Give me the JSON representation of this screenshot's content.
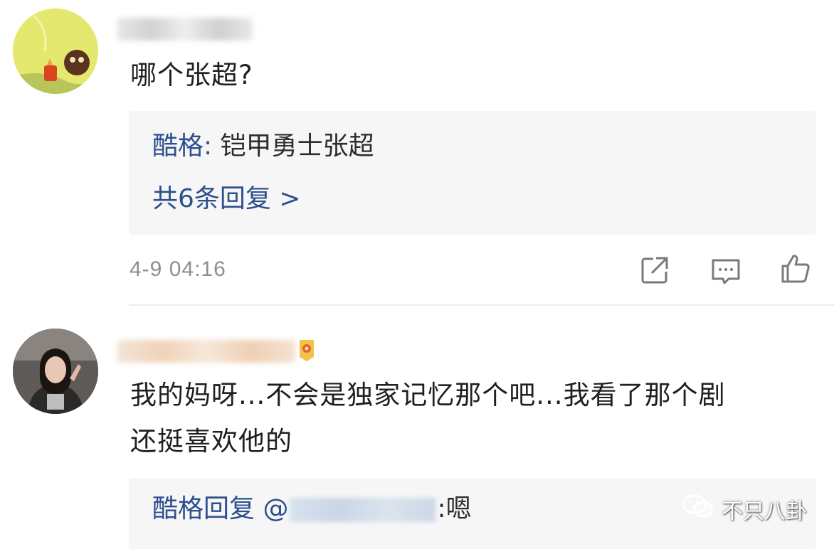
{
  "comments": [
    {
      "text": "哪个张超?",
      "reply_preview": {
        "author": "酷格:",
        "text": " 铠甲勇士张超",
        "more_label": "共6条回复 >"
      },
      "time": "4-9 04:16",
      "actions": [
        "share-icon",
        "comment-icon",
        "like-icon"
      ]
    },
    {
      "text_line1": "我的妈呀...不会是独家记忆那个吧...我看了那个剧",
      "text_line2": "还挺喜欢他的",
      "reply_preview": {
        "author_prefix": "酷格回复 @",
        "suffix": ":嗯"
      }
    }
  ],
  "watermark": {
    "text": "不只八卦",
    "icon": "wechat-icon"
  },
  "colors": {
    "link_blue": "#2d4f8d",
    "reply_bg": "#f6f6f7",
    "meta_gray": "#8e8e8e"
  }
}
